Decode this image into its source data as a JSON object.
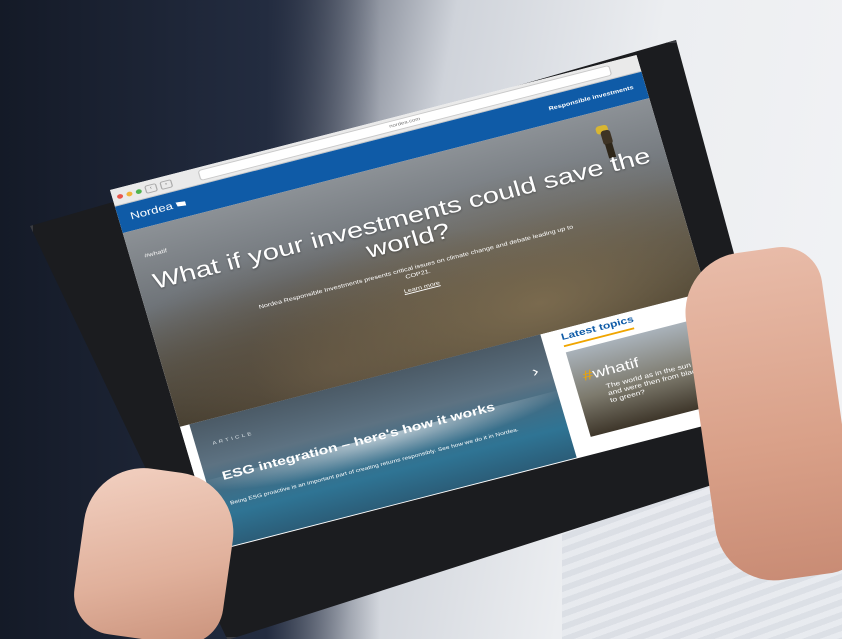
{
  "browser": {
    "url": "nordea.com",
    "back": "‹",
    "forward": "›"
  },
  "header": {
    "logo": "Nordea",
    "link": "Responsible investments"
  },
  "hero": {
    "tag": "#whatif",
    "title": "What if your investments could save the world?",
    "description": "Nordea Responsible Investments presents critical issues on climate change and debate leading up to COP21.",
    "cta": "Learn more"
  },
  "article": {
    "label": "ARTICLE",
    "title": "ESG integration – here's how it works",
    "description": "Being ESG proactive is an important part of creating returns responsibly. See how we do it in Nordea.",
    "arrow": "›"
  },
  "sidebar": {
    "title": "Latest topics",
    "card": {
      "hash": "#",
      "word": "whatif",
      "text": "The world as in the sun and were then from black to green?"
    }
  },
  "colors": {
    "brand_blue": "#0f5ba7",
    "accent_orange": "#f0a500"
  }
}
